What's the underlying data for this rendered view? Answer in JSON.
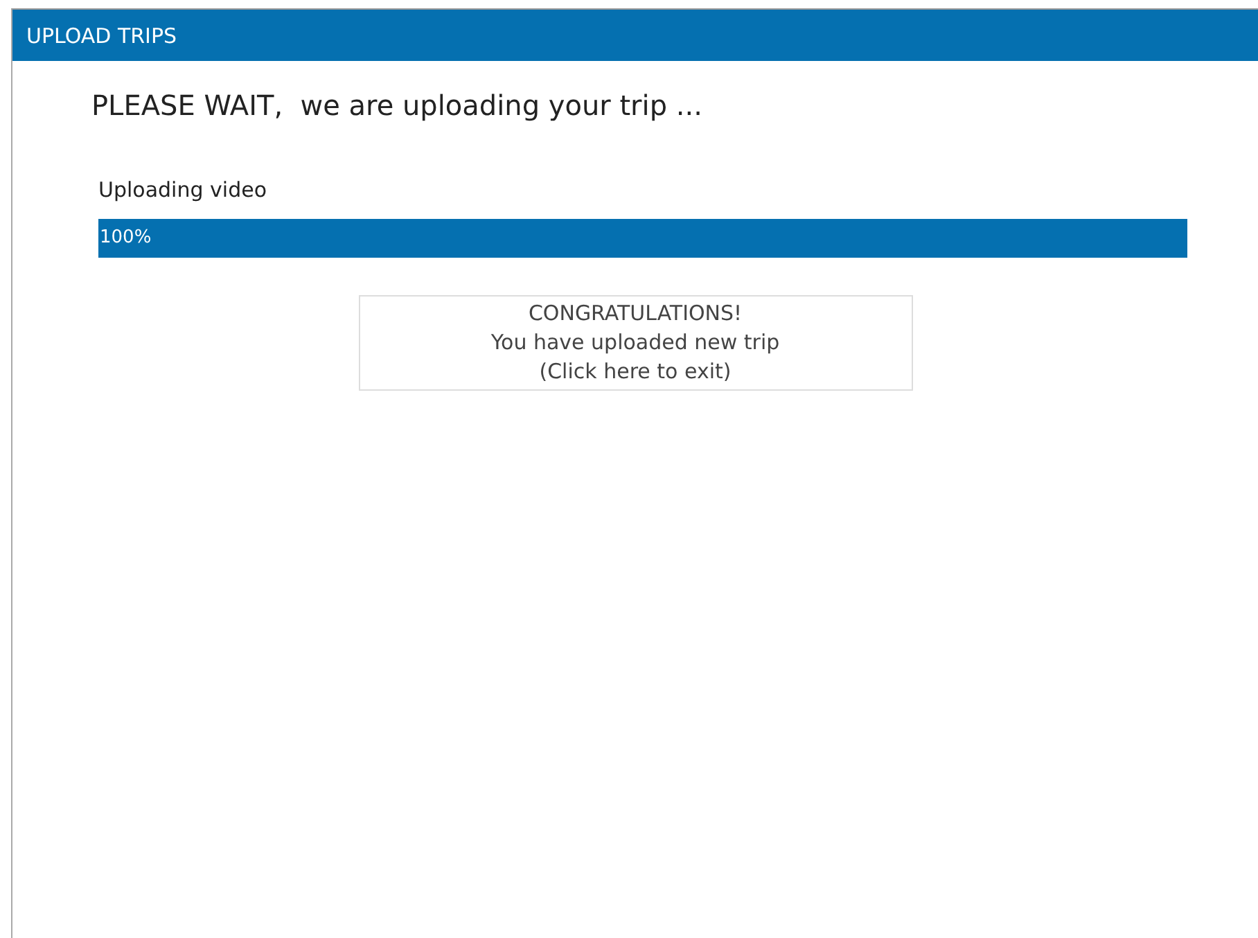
{
  "window": {
    "title": "UPLOAD TRIPS"
  },
  "heading": "PLEASE WAIT,  we are uploading your trip ...",
  "progress": {
    "label": "Uploading video",
    "level": 1,
    "reading": "100%"
  },
  "result_button": {
    "lines": [
      "CONGRATULATIONS!",
      "You have uploaded new trip",
      "(Click here to exit)"
    ]
  }
}
